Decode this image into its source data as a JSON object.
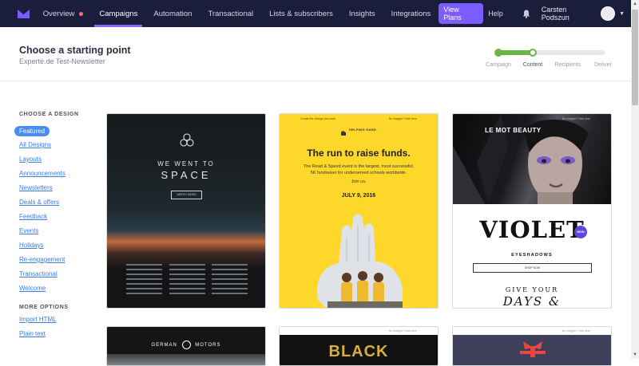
{
  "nav": {
    "items": [
      "Overview",
      "Campaigns",
      "Automation",
      "Transactional",
      "Lists & subscribers",
      "Insights",
      "Integrations"
    ],
    "active": "Campaigns",
    "view_plans": "View Plans",
    "help": "Help",
    "user_name": "Carsten Podszun"
  },
  "header": {
    "title": "Choose a starting point",
    "subtitle": "Experte.de Test-Newsletter",
    "steps": [
      "Campaign",
      "Content",
      "Recipients",
      "Deliver"
    ]
  },
  "sidebar": {
    "design_heading": "CHOOSE A DESIGN",
    "featured": "Featured",
    "design_links": [
      "All Designs",
      "Layouts",
      "Announcements",
      "Newsletters",
      "Deals & offers",
      "Feedback",
      "Events",
      "Holidays",
      "Re-engagement",
      "Transactional",
      "Welcome"
    ],
    "more_heading": "MORE OPTIONS",
    "more_links": [
      "Import HTML",
      "Plain text"
    ]
  },
  "templates": {
    "space": {
      "line1": "WE WENT TO",
      "line2": "SPACE",
      "button": "WATCH VIDEO"
    },
    "charity": {
      "top_left": "Create the change you want",
      "top_right": "No images? Click here",
      "logo": "HELPING HAND",
      "title": "The run to raise funds.",
      "body1": "The Read & Speed event is the largest, most successful,",
      "body2": "5K fundraiser for underserved schools worldwide.",
      "join": "Join us.",
      "date": "JULY 9, 2016"
    },
    "beauty": {
      "top_right": "No images? Click here",
      "brand": "LE MOT BEAUTY",
      "product": "VIOLET",
      "badge": "NEW",
      "subtitle": "EYESHADOWS",
      "button": "SHOP NOW",
      "give": "GIVE YOUR",
      "days": "DAYS &"
    },
    "motors": {
      "brand_left": "GERMAN",
      "brand_right": "MOTORS"
    },
    "black": {
      "top_right": "No images? Click here",
      "headline": "BLACK"
    },
    "gift": {
      "top_right": "No images? Click here"
    }
  },
  "colors": {
    "nav_bg": "#1b1e3a",
    "accent": "#8f63ff",
    "link": "#3a7de6",
    "progress": "#6bb545",
    "charity_yellow": "#fdd82a"
  }
}
